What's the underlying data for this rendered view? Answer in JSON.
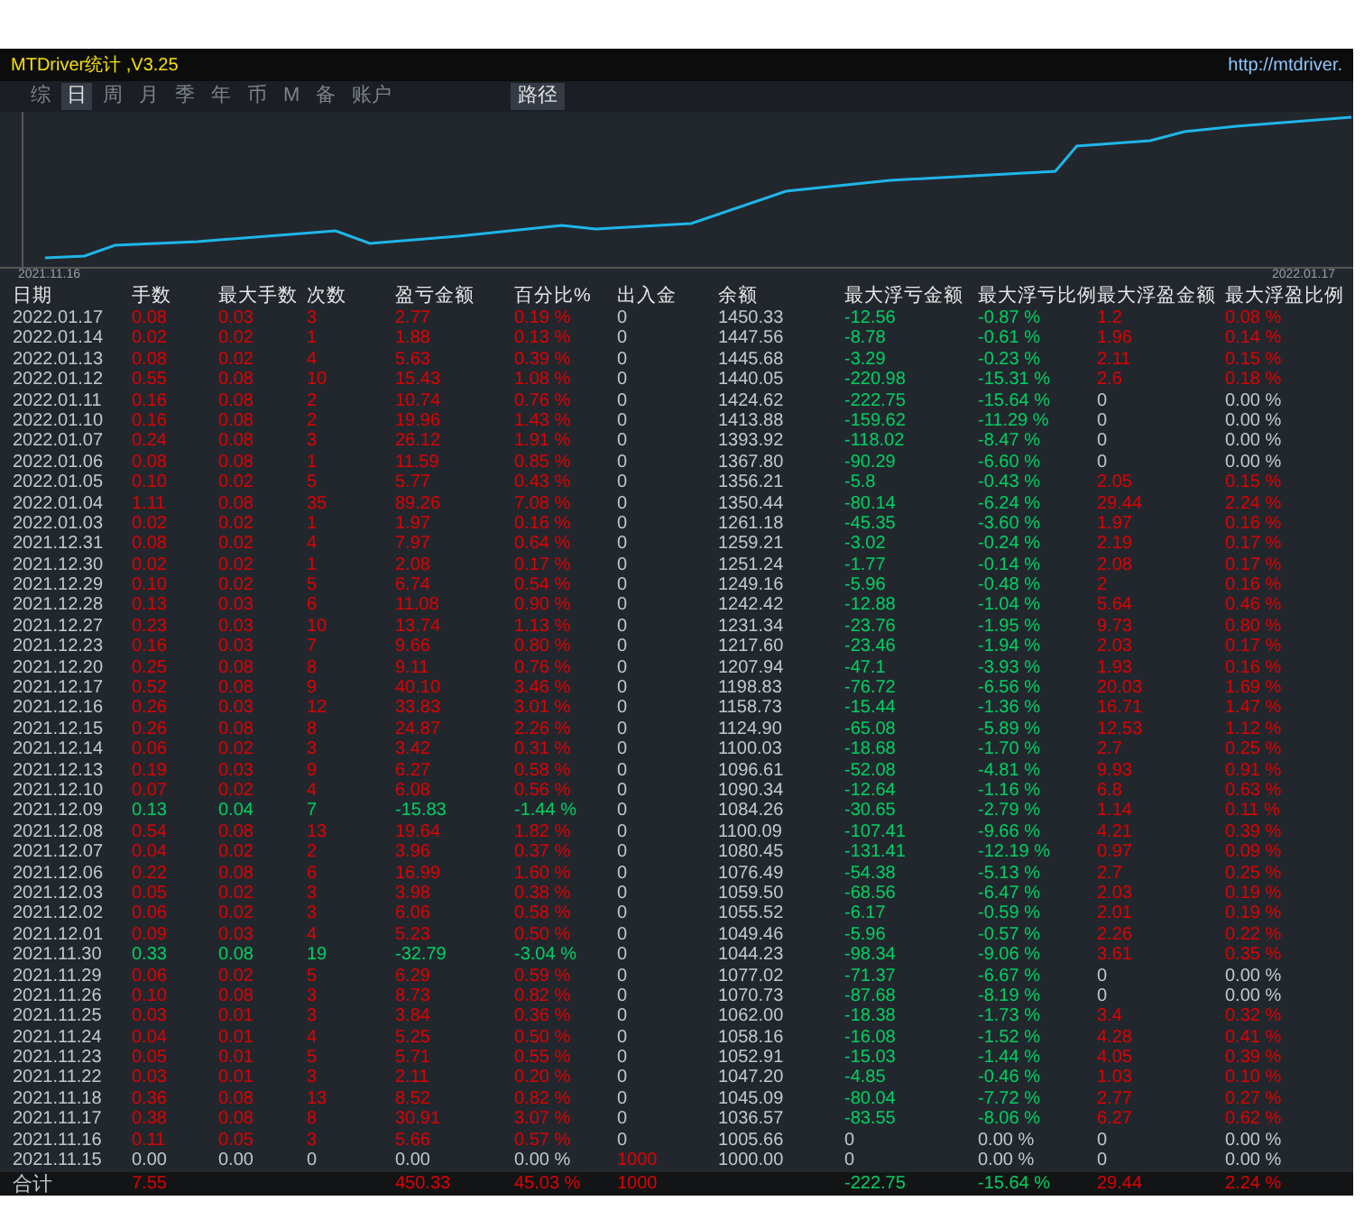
{
  "window": {
    "title": "MTDriver统计 ,V3.25",
    "url": "http://mtdriver."
  },
  "tabs": [
    {
      "label": "综",
      "selected": false
    },
    {
      "label": "日",
      "selected": true
    },
    {
      "label": "周",
      "selected": false
    },
    {
      "label": "月",
      "selected": false
    },
    {
      "label": "季",
      "selected": false
    },
    {
      "label": "年",
      "selected": false
    },
    {
      "label": "币",
      "selected": false
    },
    {
      "label": "M",
      "selected": false
    },
    {
      "label": "备",
      "selected": false
    },
    {
      "label": "账户",
      "selected": false
    }
  ],
  "path_button": "路径",
  "chart": {
    "start_label": "2021.11.16",
    "end_label": "2022.01.17"
  },
  "table": {
    "columns": [
      "日期",
      "手数",
      "最大手数",
      "次数",
      "盈亏金额",
      "百分比%",
      "出入金",
      "余额",
      "最大浮亏金额",
      "最大浮亏比例",
      "最大浮盈金额",
      "最大浮盈比例"
    ],
    "rows": [
      {
        "kind": "profit",
        "deposit": false,
        "drawdown": true,
        "gain": true,
        "cells": [
          "2022.01.17",
          "0.08",
          "0.03",
          "3",
          "2.77",
          "0.19 %",
          "0",
          "1450.33",
          "-12.56",
          "-0.87 %",
          "1.2",
          "0.08 %"
        ]
      },
      {
        "kind": "profit",
        "deposit": false,
        "drawdown": true,
        "gain": true,
        "cells": [
          "2022.01.14",
          "0.02",
          "0.02",
          "1",
          "1.88",
          "0.13 %",
          "0",
          "1447.56",
          "-8.78",
          "-0.61 %",
          "1.96",
          "0.14 %"
        ]
      },
      {
        "kind": "profit",
        "deposit": false,
        "drawdown": true,
        "gain": true,
        "cells": [
          "2022.01.13",
          "0.08",
          "0.02",
          "4",
          "5.63",
          "0.39 %",
          "0",
          "1445.68",
          "-3.29",
          "-0.23 %",
          "2.11",
          "0.15 %"
        ]
      },
      {
        "kind": "profit",
        "deposit": false,
        "drawdown": true,
        "gain": true,
        "cells": [
          "2022.01.12",
          "0.55",
          "0.08",
          "10",
          "15.43",
          "1.08 %",
          "0",
          "1440.05",
          "-220.98",
          "-15.31 %",
          "2.6",
          "0.18 %"
        ]
      },
      {
        "kind": "profit",
        "deposit": false,
        "drawdown": true,
        "gain": false,
        "cells": [
          "2022.01.11",
          "0.16",
          "0.08",
          "2",
          "10.74",
          "0.76 %",
          "0",
          "1424.62",
          "-222.75",
          "-15.64 %",
          "0",
          "0.00 %"
        ]
      },
      {
        "kind": "profit",
        "deposit": false,
        "drawdown": true,
        "gain": false,
        "cells": [
          "2022.01.10",
          "0.16",
          "0.08",
          "2",
          "19.96",
          "1.43 %",
          "0",
          "1413.88",
          "-159.62",
          "-11.29 %",
          "0",
          "0.00 %"
        ]
      },
      {
        "kind": "profit",
        "deposit": false,
        "drawdown": true,
        "gain": false,
        "cells": [
          "2022.01.07",
          "0.24",
          "0.08",
          "3",
          "26.12",
          "1.91 %",
          "0",
          "1393.92",
          "-118.02",
          "-8.47 %",
          "0",
          "0.00 %"
        ]
      },
      {
        "kind": "profit",
        "deposit": false,
        "drawdown": true,
        "gain": false,
        "cells": [
          "2022.01.06",
          "0.08",
          "0.08",
          "1",
          "11.59",
          "0.85 %",
          "0",
          "1367.80",
          "-90.29",
          "-6.60 %",
          "0",
          "0.00 %"
        ]
      },
      {
        "kind": "profit",
        "deposit": false,
        "drawdown": true,
        "gain": true,
        "cells": [
          "2022.01.05",
          "0.10",
          "0.02",
          "5",
          "5.77",
          "0.43 %",
          "0",
          "1356.21",
          "-5.8",
          "-0.43 %",
          "2.05",
          "0.15 %"
        ]
      },
      {
        "kind": "profit",
        "deposit": false,
        "drawdown": true,
        "gain": true,
        "cells": [
          "2022.01.04",
          "1.11",
          "0.08",
          "35",
          "89.26",
          "7.08 %",
          "0",
          "1350.44",
          "-80.14",
          "-6.24 %",
          "29.44",
          "2.24 %"
        ]
      },
      {
        "kind": "profit",
        "deposit": false,
        "drawdown": true,
        "gain": true,
        "cells": [
          "2022.01.03",
          "0.02",
          "0.02",
          "1",
          "1.97",
          "0.16 %",
          "0",
          "1261.18",
          "-45.35",
          "-3.60 %",
          "1.97",
          "0.16 %"
        ]
      },
      {
        "kind": "profit",
        "deposit": false,
        "drawdown": true,
        "gain": true,
        "cells": [
          "2021.12.31",
          "0.08",
          "0.02",
          "4",
          "7.97",
          "0.64 %",
          "0",
          "1259.21",
          "-3.02",
          "-0.24 %",
          "2.19",
          "0.17 %"
        ]
      },
      {
        "kind": "profit",
        "deposit": false,
        "drawdown": true,
        "gain": true,
        "cells": [
          "2021.12.30",
          "0.02",
          "0.02",
          "1",
          "2.08",
          "0.17 %",
          "0",
          "1251.24",
          "-1.77",
          "-0.14 %",
          "2.08",
          "0.17 %"
        ]
      },
      {
        "kind": "profit",
        "deposit": false,
        "drawdown": true,
        "gain": true,
        "cells": [
          "2021.12.29",
          "0.10",
          "0.02",
          "5",
          "6.74",
          "0.54 %",
          "0",
          "1249.16",
          "-5.96",
          "-0.48 %",
          "2",
          "0.16 %"
        ]
      },
      {
        "kind": "profit",
        "deposit": false,
        "drawdown": true,
        "gain": true,
        "cells": [
          "2021.12.28",
          "0.13",
          "0.03",
          "6",
          "11.08",
          "0.90 %",
          "0",
          "1242.42",
          "-12.88",
          "-1.04 %",
          "5.64",
          "0.46 %"
        ]
      },
      {
        "kind": "profit",
        "deposit": false,
        "drawdown": true,
        "gain": true,
        "cells": [
          "2021.12.27",
          "0.23",
          "0.03",
          "10",
          "13.74",
          "1.13 %",
          "0",
          "1231.34",
          "-23.76",
          "-1.95 %",
          "9.73",
          "0.80 %"
        ]
      },
      {
        "kind": "profit",
        "deposit": false,
        "drawdown": true,
        "gain": true,
        "cells": [
          "2021.12.23",
          "0.16",
          "0.03",
          "7",
          "9.66",
          "0.80 %",
          "0",
          "1217.60",
          "-23.46",
          "-1.94 %",
          "2.03",
          "0.17 %"
        ]
      },
      {
        "kind": "profit",
        "deposit": false,
        "drawdown": true,
        "gain": true,
        "cells": [
          "2021.12.20",
          "0.25",
          "0.08",
          "8",
          "9.11",
          "0.76 %",
          "0",
          "1207.94",
          "-47.1",
          "-3.93 %",
          "1.93",
          "0.16 %"
        ]
      },
      {
        "kind": "profit",
        "deposit": false,
        "drawdown": true,
        "gain": true,
        "cells": [
          "2021.12.17",
          "0.52",
          "0.08",
          "9",
          "40.10",
          "3.46 %",
          "0",
          "1198.83",
          "-76.72",
          "-6.56 %",
          "20.03",
          "1.69 %"
        ]
      },
      {
        "kind": "profit",
        "deposit": false,
        "drawdown": true,
        "gain": true,
        "cells": [
          "2021.12.16",
          "0.26",
          "0.03",
          "12",
          "33.83",
          "3.01 %",
          "0",
          "1158.73",
          "-15.44",
          "-1.36 %",
          "16.71",
          "1.47 %"
        ]
      },
      {
        "kind": "profit",
        "deposit": false,
        "drawdown": true,
        "gain": true,
        "cells": [
          "2021.12.15",
          "0.26",
          "0.08",
          "8",
          "24.87",
          "2.26 %",
          "0",
          "1124.90",
          "-65.08",
          "-5.89 %",
          "12.53",
          "1.12 %"
        ]
      },
      {
        "kind": "profit",
        "deposit": false,
        "drawdown": true,
        "gain": true,
        "cells": [
          "2021.12.14",
          "0.06",
          "0.02",
          "3",
          "3.42",
          "0.31 %",
          "0",
          "1100.03",
          "-18.68",
          "-1.70 %",
          "2.7",
          "0.25 %"
        ]
      },
      {
        "kind": "profit",
        "deposit": false,
        "drawdown": true,
        "gain": true,
        "cells": [
          "2021.12.13",
          "0.19",
          "0.03",
          "9",
          "6.27",
          "0.58 %",
          "0",
          "1096.61",
          "-52.08",
          "-4.81 %",
          "9.93",
          "0.91 %"
        ]
      },
      {
        "kind": "profit",
        "deposit": false,
        "drawdown": true,
        "gain": true,
        "cells": [
          "2021.12.10",
          "0.07",
          "0.02",
          "4",
          "6.08",
          "0.56 %",
          "0",
          "1090.34",
          "-12.64",
          "-1.16 %",
          "6.8",
          "0.63 %"
        ]
      },
      {
        "kind": "loss",
        "deposit": false,
        "drawdown": true,
        "gain": true,
        "cells": [
          "2021.12.09",
          "0.13",
          "0.04",
          "7",
          "-15.83",
          "-1.44 %",
          "0",
          "1084.26",
          "-30.65",
          "-2.79 %",
          "1.14",
          "0.11 %"
        ]
      },
      {
        "kind": "profit",
        "deposit": false,
        "drawdown": true,
        "gain": true,
        "cells": [
          "2021.12.08",
          "0.54",
          "0.08",
          "13",
          "19.64",
          "1.82 %",
          "0",
          "1100.09",
          "-107.41",
          "-9.66 %",
          "4.21",
          "0.39 %"
        ]
      },
      {
        "kind": "profit",
        "deposit": false,
        "drawdown": true,
        "gain": true,
        "cells": [
          "2021.12.07",
          "0.04",
          "0.02",
          "2",
          "3.96",
          "0.37 %",
          "0",
          "1080.45",
          "-131.41",
          "-12.19 %",
          "0.97",
          "0.09 %"
        ]
      },
      {
        "kind": "profit",
        "deposit": false,
        "drawdown": true,
        "gain": true,
        "cells": [
          "2021.12.06",
          "0.22",
          "0.08",
          "6",
          "16.99",
          "1.60 %",
          "0",
          "1076.49",
          "-54.38",
          "-5.13 %",
          "2.7",
          "0.25 %"
        ]
      },
      {
        "kind": "profit",
        "deposit": false,
        "drawdown": true,
        "gain": true,
        "cells": [
          "2021.12.03",
          "0.05",
          "0.02",
          "3",
          "3.98",
          "0.38 %",
          "0",
          "1059.50",
          "-68.56",
          "-6.47 %",
          "2.03",
          "0.19 %"
        ]
      },
      {
        "kind": "profit",
        "deposit": false,
        "drawdown": true,
        "gain": true,
        "cells": [
          "2021.12.02",
          "0.06",
          "0.02",
          "3",
          "6.06",
          "0.58 %",
          "0",
          "1055.52",
          "-6.17",
          "-0.59 %",
          "2.01",
          "0.19 %"
        ]
      },
      {
        "kind": "profit",
        "deposit": false,
        "drawdown": true,
        "gain": true,
        "cells": [
          "2021.12.01",
          "0.09",
          "0.03",
          "4",
          "5.23",
          "0.50 %",
          "0",
          "1049.46",
          "-5.96",
          "-0.57 %",
          "2.26",
          "0.22 %"
        ]
      },
      {
        "kind": "loss",
        "deposit": false,
        "drawdown": true,
        "gain": true,
        "cells": [
          "2021.11.30",
          "0.33",
          "0.08",
          "19",
          "-32.79",
          "-3.04 %",
          "0",
          "1044.23",
          "-98.34",
          "-9.06 %",
          "3.61",
          "0.35 %"
        ]
      },
      {
        "kind": "profit",
        "deposit": false,
        "drawdown": true,
        "gain": false,
        "cells": [
          "2021.11.29",
          "0.06",
          "0.02",
          "5",
          "6.29",
          "0.59 %",
          "0",
          "1077.02",
          "-71.37",
          "-6.67 %",
          "0",
          "0.00 %"
        ]
      },
      {
        "kind": "profit",
        "deposit": false,
        "drawdown": true,
        "gain": false,
        "cells": [
          "2021.11.26",
          "0.10",
          "0.08",
          "3",
          "8.73",
          "0.82 %",
          "0",
          "1070.73",
          "-87.68",
          "-8.19 %",
          "0",
          "0.00 %"
        ]
      },
      {
        "kind": "profit",
        "deposit": false,
        "drawdown": true,
        "gain": true,
        "cells": [
          "2021.11.25",
          "0.03",
          "0.01",
          "3",
          "3.84",
          "0.36 %",
          "0",
          "1062.00",
          "-18.38",
          "-1.73 %",
          "3.4",
          "0.32 %"
        ]
      },
      {
        "kind": "profit",
        "deposit": false,
        "drawdown": true,
        "gain": true,
        "cells": [
          "2021.11.24",
          "0.04",
          "0.01",
          "4",
          "5.25",
          "0.50 %",
          "0",
          "1058.16",
          "-16.08",
          "-1.52 %",
          "4.28",
          "0.41 %"
        ]
      },
      {
        "kind": "profit",
        "deposit": false,
        "drawdown": true,
        "gain": true,
        "cells": [
          "2021.11.23",
          "0.05",
          "0.01",
          "5",
          "5.71",
          "0.55 %",
          "0",
          "1052.91",
          "-15.03",
          "-1.44 %",
          "4.05",
          "0.39 %"
        ]
      },
      {
        "kind": "profit",
        "deposit": false,
        "drawdown": true,
        "gain": true,
        "cells": [
          "2021.11.22",
          "0.03",
          "0.01",
          "3",
          "2.11",
          "0.20 %",
          "0",
          "1047.20",
          "-4.85",
          "-0.46 %",
          "1.03",
          "0.10 %"
        ]
      },
      {
        "kind": "profit",
        "deposit": false,
        "drawdown": true,
        "gain": true,
        "cells": [
          "2021.11.18",
          "0.36",
          "0.08",
          "13",
          "8.52",
          "0.82 %",
          "0",
          "1045.09",
          "-80.04",
          "-7.72 %",
          "2.77",
          "0.27 %"
        ]
      },
      {
        "kind": "profit",
        "deposit": false,
        "drawdown": true,
        "gain": true,
        "cells": [
          "2021.11.17",
          "0.38",
          "0.08",
          "8",
          "30.91",
          "3.07 %",
          "0",
          "1036.57",
          "-83.55",
          "-8.06 %",
          "6.27",
          "0.62 %"
        ]
      },
      {
        "kind": "profit",
        "deposit": false,
        "drawdown": false,
        "gain": false,
        "cells": [
          "2021.11.16",
          "0.11",
          "0.05",
          "3",
          "5.66",
          "0.57 %",
          "0",
          "1005.66",
          "0",
          "0.00 %",
          "0",
          "0.00 %"
        ]
      },
      {
        "kind": "flat",
        "deposit": true,
        "drawdown": false,
        "gain": false,
        "cells": [
          "2021.11.15",
          "0.00",
          "0.00",
          "0",
          "0.00",
          "0.00 %",
          "1000",
          "1000.00",
          "0",
          "0.00 %",
          "0",
          "0.00 %"
        ]
      }
    ],
    "total": {
      "label": "合计",
      "lots": "7.55",
      "pnl": "450.33",
      "percent": "45.03 %",
      "deposit": "1000",
      "drawdown": "-222.75",
      "drawdown_pct": "-15.64 %",
      "gain": "29.44",
      "gain_pct": "2.24 %"
    }
  }
}
